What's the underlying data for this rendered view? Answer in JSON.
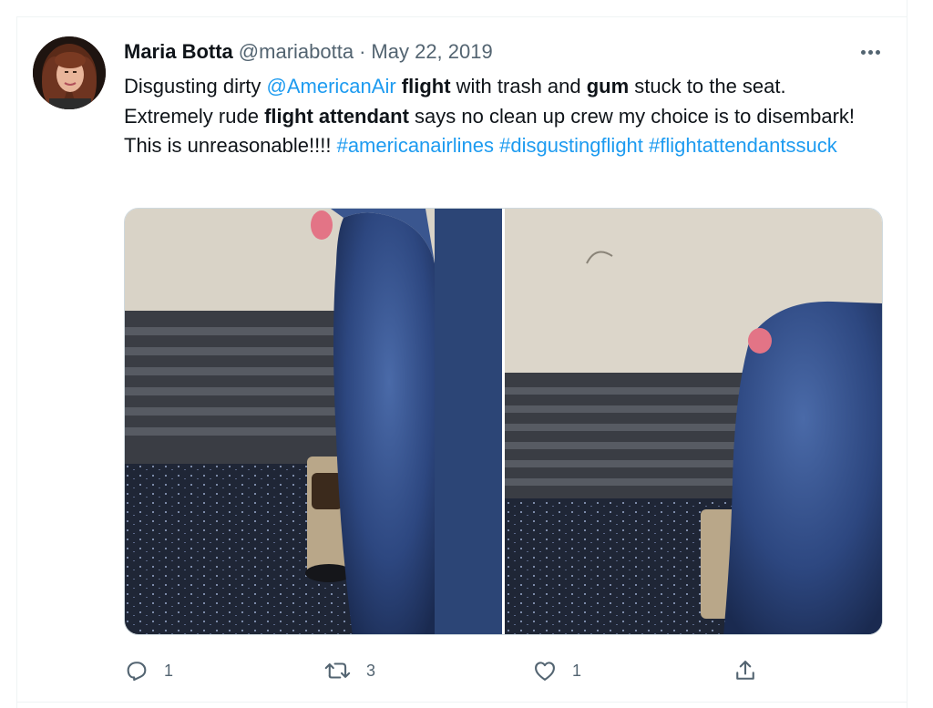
{
  "tweet": {
    "author_name": "Maria Botta",
    "handle": "@mariabotta",
    "separator": "·",
    "date": "May 22, 2019",
    "text": {
      "t1": "Disgusting dirty ",
      "mention": "@AmericanAir",
      "t2": " ",
      "b1": "flight",
      "t3": " with trash and ",
      "b2": "gum",
      "t4": " stuck to the seat. Extremely rude ",
      "b3": "flight attendant",
      "t5": " says no clean up crew my choice is to disembark! This is unreasonable!!!! ",
      "hashtag1": "#americanairlines",
      "t6": " ",
      "hashtag2": "#disgustingflight",
      "t7": " ",
      "hashtag3": "#flightattendantssuck"
    }
  },
  "actions": {
    "reply_count": "1",
    "retweet_count": "3",
    "like_count": "1"
  },
  "icons": {
    "more": "more-horizontal-icon",
    "reply": "reply-icon",
    "retweet": "retweet-icon",
    "like": "heart-icon",
    "share": "share-icon"
  },
  "colors": {
    "accent": "#1d9bf0",
    "text_primary": "#0f1419",
    "text_secondary": "#536471",
    "border": "#cfd9de"
  }
}
